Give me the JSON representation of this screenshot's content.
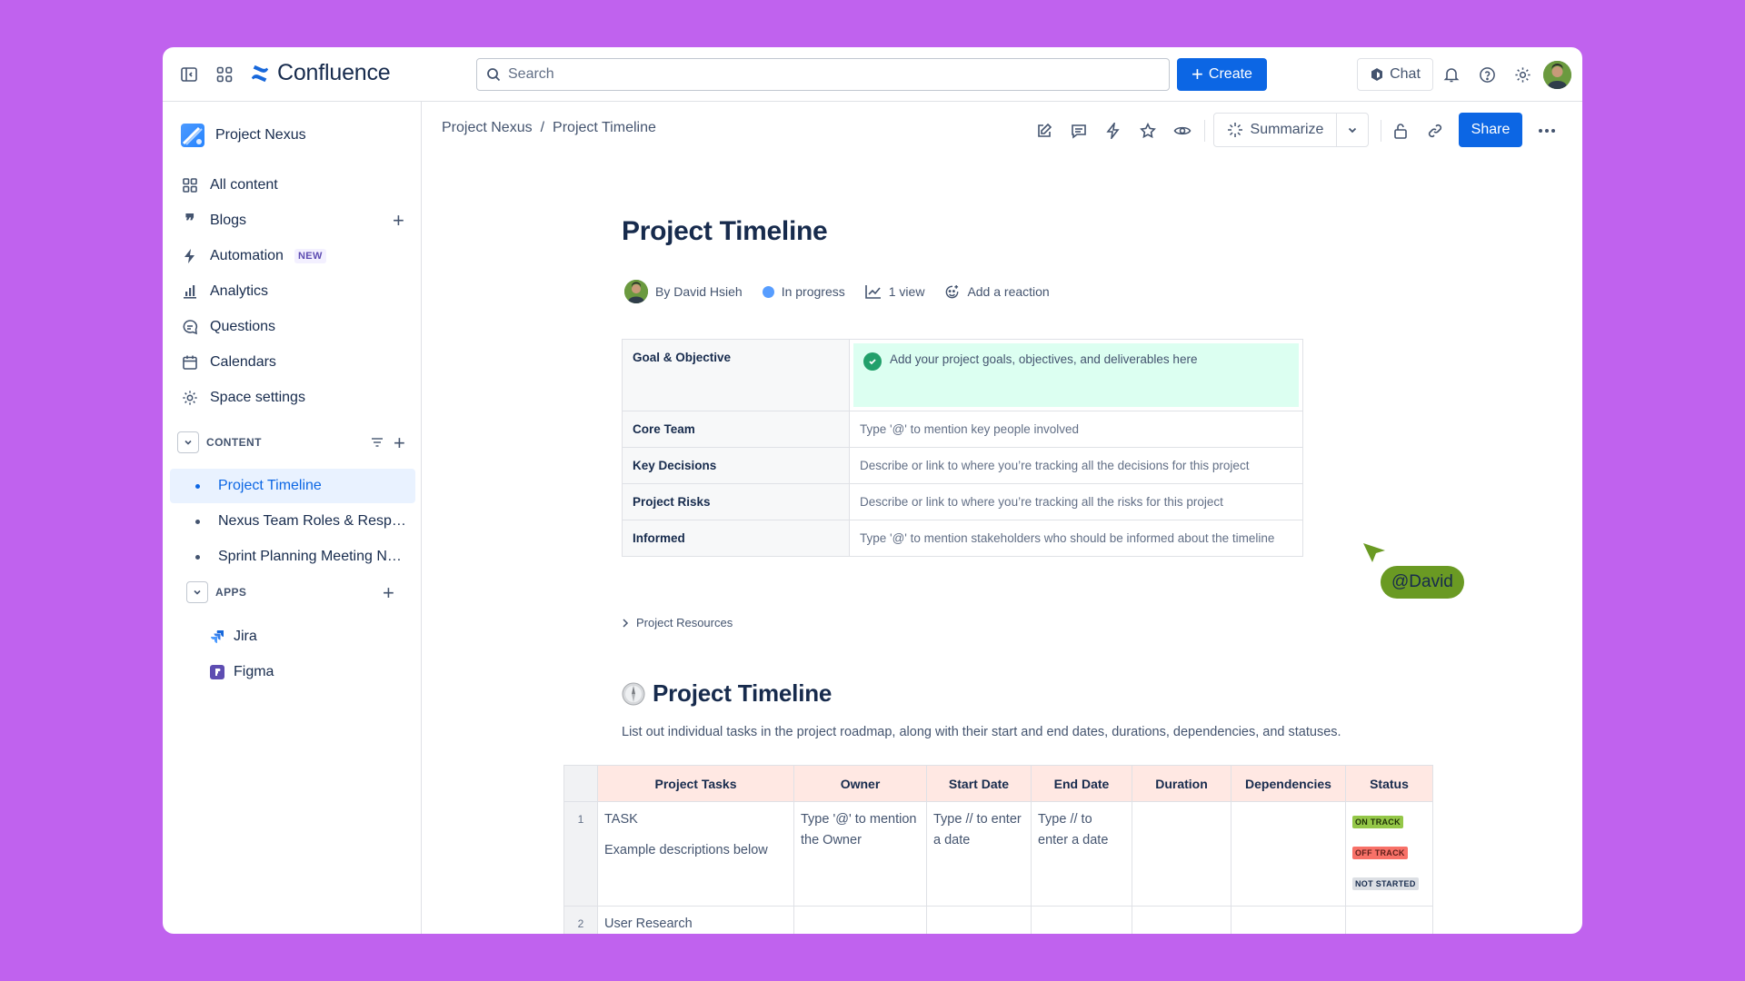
{
  "app": {
    "name": "Confluence"
  },
  "topbar": {
    "search_placeholder": "Search",
    "create_label": "Create",
    "chat_label": "Chat"
  },
  "sidebar": {
    "space_name": "Project Nexus",
    "items": [
      {
        "label": "All content"
      },
      {
        "label": "Blogs"
      },
      {
        "label": "Automation",
        "badge": "NEW"
      },
      {
        "label": "Analytics"
      },
      {
        "label": "Questions"
      },
      {
        "label": "Calendars"
      },
      {
        "label": "Space settings"
      }
    ],
    "content_section": "CONTENT",
    "tree": [
      {
        "label": "Project Timeline"
      },
      {
        "label": "Nexus Team Roles & Responsibilities"
      },
      {
        "label": "Sprint Planning Meeting Notes"
      }
    ],
    "apps_section": "APPS",
    "apps": [
      {
        "label": "Jira"
      },
      {
        "label": "Figma"
      }
    ]
  },
  "breadcrumb": {
    "space": "Project Nexus",
    "sep": "/",
    "page": "Project Timeline"
  },
  "page_header": {
    "summarize_label": "Summarize",
    "share_label": "Share"
  },
  "page": {
    "title": "Project Timeline",
    "author": "By David Hsieh",
    "status": "In progress",
    "views": "1 view",
    "reaction": "Add a reaction",
    "info_table": [
      {
        "key": "Goal & Objective",
        "value": "Add your project goals, objectives, and deliverables here"
      },
      {
        "key": "Core Team",
        "value": "Type '@' to mention key people involved"
      },
      {
        "key": "Key Decisions",
        "value": "Describe or link to where you’re tracking all the decisions for this project"
      },
      {
        "key": "Project Risks",
        "value": "Describe or link to where you’re tracking all the risks for this project"
      },
      {
        "key": "Informed",
        "value": "Type '@' to mention stakeholders who should be informed about the timeline"
      }
    ],
    "resources_label": "Project Resources",
    "cursor_label": "@David",
    "section_title": "Project Timeline",
    "section_desc": "List out individual tasks in the project roadmap, along with their start and end dates, durations, dependencies, and statuses.",
    "tasks_table": {
      "headers": [
        "Project Tasks",
        "Owner",
        "Start Date",
        "End Date",
        "Duration",
        "Dependencies",
        "Status"
      ],
      "rows": [
        {
          "num": "1",
          "task": "TASK",
          "task_desc": "Example descriptions below",
          "owner": "Type '@' to mention the Owner",
          "start": "Type // to enter a date",
          "end": "Type // to enter a date",
          "status": [
            "ON TRACK",
            "OFF TRACK",
            "NOT STARTED"
          ]
        },
        {
          "num": "2",
          "task": "User Research"
        }
      ]
    }
  },
  "colors": {
    "background": "#c062ee",
    "primary": "#0c66e4",
    "goal_bg": "#dcfff1",
    "header_bg": "#ffe8e3",
    "on_track": "#94c748",
    "off_track": "#f87168",
    "not_started": "#dcdfe4",
    "cursor": "#6a9a23"
  }
}
